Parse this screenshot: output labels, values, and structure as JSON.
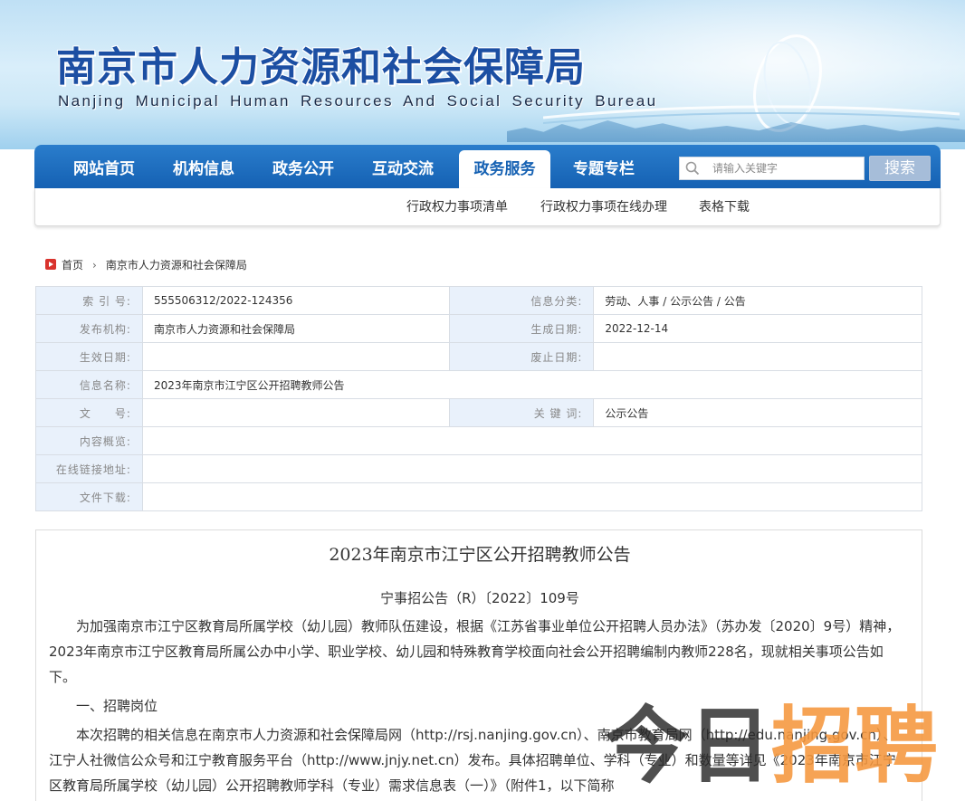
{
  "header": {
    "title": "南京市人力资源和社会保障局",
    "subtitle": "Nanjing Municipal Human Resources And Social Security Bureau"
  },
  "nav": {
    "items": [
      {
        "label": "网站首页"
      },
      {
        "label": "机构信息"
      },
      {
        "label": "政务公开"
      },
      {
        "label": "互动交流"
      },
      {
        "label": "政务服务",
        "active": true
      },
      {
        "label": "专题专栏"
      }
    ],
    "search_placeholder": "请输入关键字",
    "search_button": "搜索",
    "sub_items": [
      "行政权力事项清单",
      "行政权力事项在线办理",
      "表格下载"
    ]
  },
  "breadcrumb": {
    "home": "首页",
    "current": "南京市人力资源和社会保障局"
  },
  "info": {
    "index_label": "索 引 号:",
    "index_value": "555506312/2022-124356",
    "category_label": "信息分类:",
    "category_value": "劳动、人事 / 公示公告 / 公告",
    "publisher_label": "发布机构:",
    "publisher_value": "南京市人力资源和社会保障局",
    "created_label": "生成日期:",
    "created_value": "2022-12-14",
    "effective_label": "生效日期:",
    "effective_value": "",
    "abolished_label": "废止日期:",
    "abolished_value": "",
    "name_label": "信息名称:",
    "name_value": "2023年南京市江宁区公开招聘教师公告",
    "docno_label": "文　　号:",
    "docno_value": "",
    "keywords_label": "关 键 词:",
    "keywords_value": "公示公告",
    "overview_label": "内容概览:",
    "overview_value": "",
    "link_label": "在线链接地址:",
    "link_value": "",
    "download_label": "文件下载:",
    "download_value": ""
  },
  "article": {
    "title": "2023年南京市江宁区公开招聘教师公告",
    "doc_number": "宁事招公告（R）〔2022〕109号",
    "para1": "为加强南京市江宁区教育局所属学校（幼儿园）教师队伍建设，根据《江苏省事业单位公开招聘人员办法》（苏办发〔2020〕9号）精神，2023年南京市江宁区教育局所属公办中小学、职业学校、幼儿园和特殊教育学校面向社会公开招聘编制内教师228名，现就相关事项公告如下。",
    "heading1": "一、招聘岗位",
    "para2": "本次招聘的相关信息在南京市人力资源和社会保障局网（http://rsj.nanjing.gov.cn）、南京市教育局网（http://edu.nanjing.gov.cn）、江宁人社微信公众号和江宁教育服务平台（http://www.jnjy.net.cn）发布。具体招聘单位、学科（专业）和数量等详见《2023年南京市江宁区教育局所属学校（幼儿园）公开招聘教师学科（专业）需求信息表（一）》（附件1，以下简称"
  },
  "watermark": {
    "part1": "今日",
    "part2": "招聘"
  }
}
